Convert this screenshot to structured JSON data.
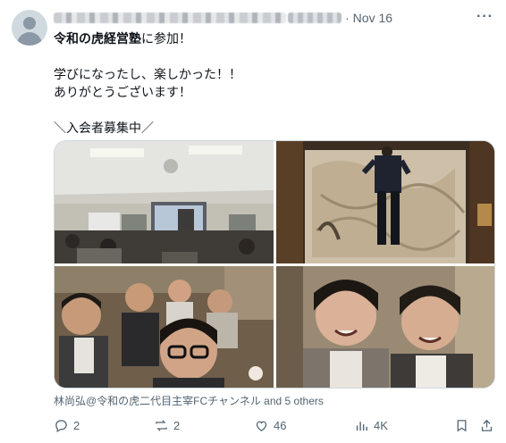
{
  "tweet": {
    "date": "Nov 16",
    "separator": "·",
    "text": {
      "line1_bold": "令和の虎経営塾",
      "line1_rest": "に参加！",
      "line2": "学びになったし、楽しかった！！",
      "line3": "ありがとうございます！",
      "line4": "＼入会者募集中／"
    },
    "photo_credit": "林尚弘@令和の虎二代目主宰FCチャンネル and 5 others",
    "actions": {
      "replies": "2",
      "reposts": "2",
      "likes": "46",
      "views": "4K"
    }
  },
  "icons": [
    "avatar-placeholder",
    "more-icon",
    "reply-icon",
    "repost-icon",
    "like-icon",
    "views-icon",
    "bookmark-icon",
    "share-icon"
  ],
  "colors": {
    "secondary_text": "#536471",
    "text": "#0f1419",
    "border": "#cfd9de"
  }
}
